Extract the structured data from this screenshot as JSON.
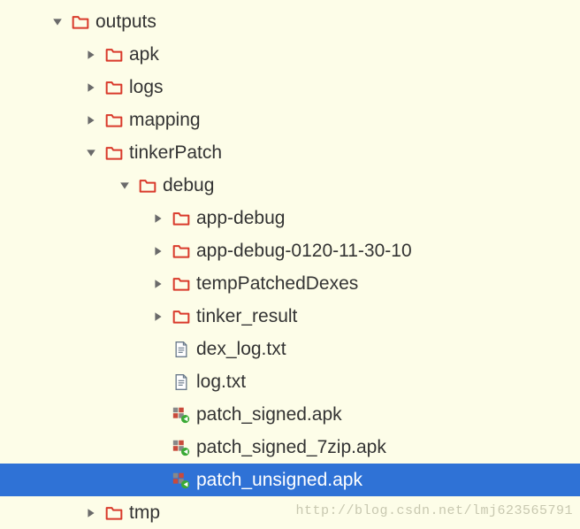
{
  "tree": {
    "baseIndent": 56,
    "step": 38,
    "items": [
      {
        "depth": 0,
        "arrow": "down",
        "icon": "folder",
        "label": "outputs",
        "selected": false
      },
      {
        "depth": 1,
        "arrow": "right",
        "icon": "folder",
        "label": "apk",
        "selected": false
      },
      {
        "depth": 1,
        "arrow": "right",
        "icon": "folder",
        "label": "logs",
        "selected": false
      },
      {
        "depth": 1,
        "arrow": "right",
        "icon": "folder",
        "label": "mapping",
        "selected": false
      },
      {
        "depth": 1,
        "arrow": "down",
        "icon": "folder",
        "label": "tinkerPatch",
        "selected": false
      },
      {
        "depth": 2,
        "arrow": "down",
        "icon": "folder",
        "label": "debug",
        "selected": false
      },
      {
        "depth": 3,
        "arrow": "right",
        "icon": "folder",
        "label": "app-debug",
        "selected": false
      },
      {
        "depth": 3,
        "arrow": "right",
        "icon": "folder",
        "label": "app-debug-0120-11-30-10",
        "selected": false
      },
      {
        "depth": 3,
        "arrow": "right",
        "icon": "folder",
        "label": "tempPatchedDexes",
        "selected": false
      },
      {
        "depth": 3,
        "arrow": "right",
        "icon": "folder",
        "label": "tinker_result",
        "selected": false
      },
      {
        "depth": 3,
        "arrow": "none",
        "icon": "txt",
        "label": "dex_log.txt",
        "selected": false
      },
      {
        "depth": 3,
        "arrow": "none",
        "icon": "txt",
        "label": "log.txt",
        "selected": false
      },
      {
        "depth": 3,
        "arrow": "none",
        "icon": "apk",
        "label": "patch_signed.apk",
        "selected": false
      },
      {
        "depth": 3,
        "arrow": "none",
        "icon": "apk",
        "label": "patch_signed_7zip.apk",
        "selected": false
      },
      {
        "depth": 3,
        "arrow": "none",
        "icon": "apk",
        "label": "patch_unsigned.apk",
        "selected": true
      },
      {
        "depth": 1,
        "arrow": "right",
        "icon": "folder",
        "label": "tmp",
        "selected": false
      }
    ]
  },
  "watermark": "http://blog.csdn.net/lmj623565791"
}
